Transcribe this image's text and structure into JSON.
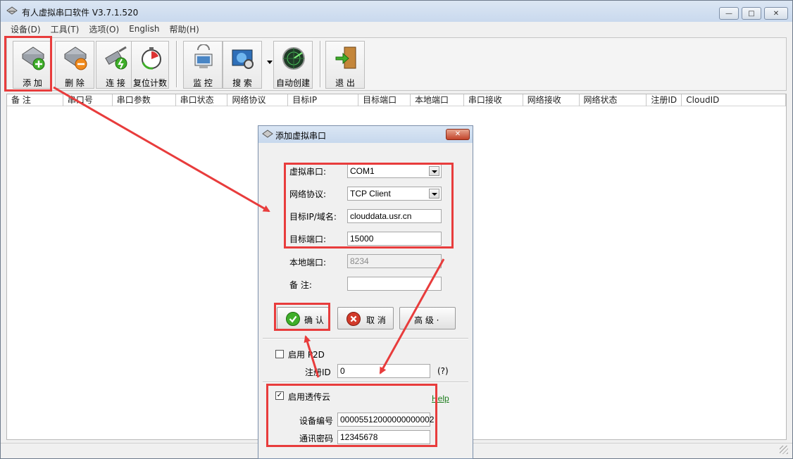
{
  "app": {
    "title": "有人虚拟串口软件 V3.7.1.520",
    "window_controls": {
      "min": "—",
      "max": "□",
      "close": "✕"
    }
  },
  "menu": [
    "设备(D)",
    "工具(T)",
    "选项(O)",
    "English",
    "帮助(H)"
  ],
  "toolbar": {
    "add": "添 加",
    "delete": "删 除",
    "connect": "连 接",
    "reset_count": "复位计数",
    "monitor": "监 控",
    "search": "搜 索",
    "auto_create": "自动创建",
    "exit": "退 出"
  },
  "grid": {
    "columns": [
      "备 注",
      "串口号",
      "串口参数",
      "串口状态",
      "网络协议",
      "目标IP",
      "目标端口",
      "本地端口",
      "串口接收",
      "网络接收",
      "网络状态",
      "注册ID",
      "CloudID"
    ]
  },
  "dialog": {
    "title": "添加虚拟串口",
    "close": "✕",
    "virtual_port_label": "虚拟串口:",
    "virtual_port_value": "COM1",
    "protocol_label": "网络协议:",
    "protocol_value": "TCP Client",
    "target_ip_label": "目标IP/域名:",
    "target_ip_value": "clouddata.usr.cn",
    "target_port_label": "目标端口:",
    "target_port_value": "15000",
    "local_port_label": "本地端口:",
    "local_port_value": "8234",
    "remark_label": "备  注:",
    "remark_value": "",
    "ok": "确 认",
    "cancel": "取 消",
    "advanced": "高 级 ·",
    "p2d_label": "启用 P2D",
    "p2d_checked": "",
    "reg_id_label": "注册ID",
    "reg_id_value": "0",
    "reg_id_help": "(?)",
    "cloud_label": "启用透传云",
    "cloud_checked": "✓",
    "help_link": "Help",
    "device_no_label": "设备编号",
    "device_no_value": "00005512000000000002",
    "password_label": "通讯密码",
    "password_value": "12345678"
  },
  "colors": {
    "annotation": "#e83c3c",
    "help_link": "#1d7d1d"
  }
}
